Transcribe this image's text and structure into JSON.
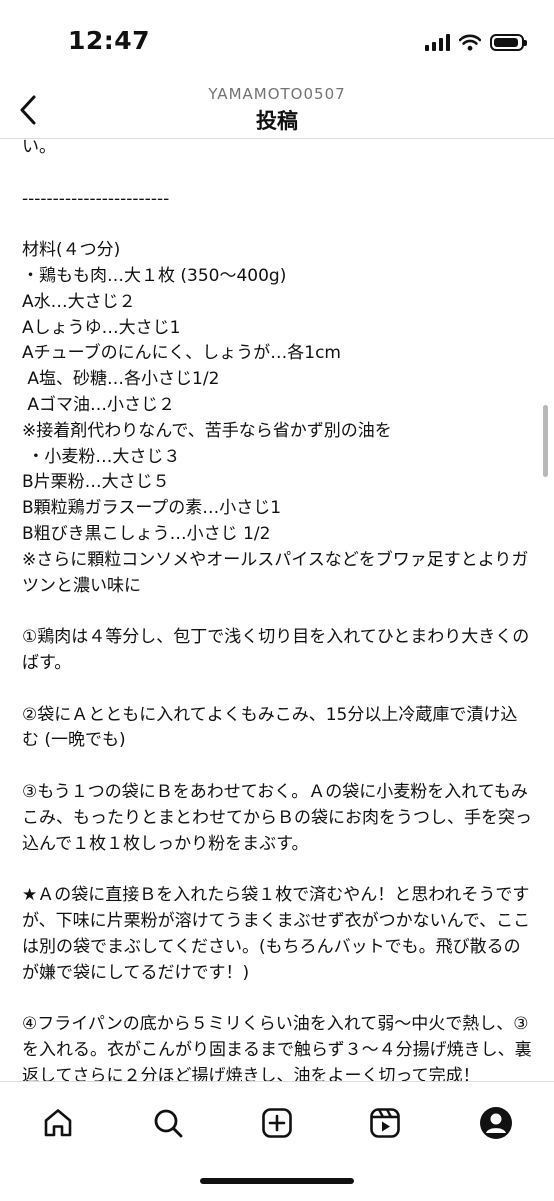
{
  "status_bar": {
    "time": "12:47"
  },
  "header": {
    "username": "YAMAMOTO0507",
    "title": "投稿"
  },
  "post": {
    "body": "い。\n\n------------------------\n\n材料(４つ分)\n・鶏もも肉…大１枚 (350～400g)\nA水…大さじ２\nAしょうゆ…大さじ1\nAチューブのにんにく、しょうが…各1cm\n A塩、砂糖…各小さじ1/2\n Aゴマ油…小さじ２\n※接着剤代わりなんで、苦手なら省かず別の油を\n ・小麦粉…大さじ３\nB片栗粉…大さじ５\nB顆粒鶏ガラスープの素…小さじ1\nB粗びき黒こしょう…小さじ 1/2\n※さらに顆粒コンソメやオールスパイスなどをブワァ足すとよりガツンと濃い味に\n\n①鶏肉は４等分し、包丁で浅く切り目を入れてひとまわり大きくのばす。\n\n②袋にＡとともに入れてよくもみこみ、15分以上冷蔵庫で漬け込む (一晩でも)\n\n③もう１つの袋にＢをあわせておく。Ａの袋に小麦粉を入れてもみこみ、もったりとまとわせてからＢの袋にお肉をうつし、手を突っ込んで１枚１枚しっかり粉をまぶす。\n\n★Ａの袋に直接Ｂを入れたら袋１枚で済むやん！と思われそうですが、下味に片栗粉が溶けてうまくまぶせず衣がつかないんで、ここは別の袋でまぶしてください。(もちろんバットでも。飛び散るのが嫌で袋にしてるだけです！)\n\n④フライパンの底から５ミリくらい油を入れて弱〜中火で熱し、③を入れる。衣がこんがり固まるまで触らず３〜４分揚げ焼きし、裏返してさらに２分ほど揚げ焼きし、油をよーく切って完成！"
  },
  "tab_bar": {
    "items": [
      {
        "icon": "home-icon"
      },
      {
        "icon": "search-icon"
      },
      {
        "icon": "create-icon"
      },
      {
        "icon": "reels-icon"
      },
      {
        "icon": "profile-icon"
      }
    ]
  }
}
